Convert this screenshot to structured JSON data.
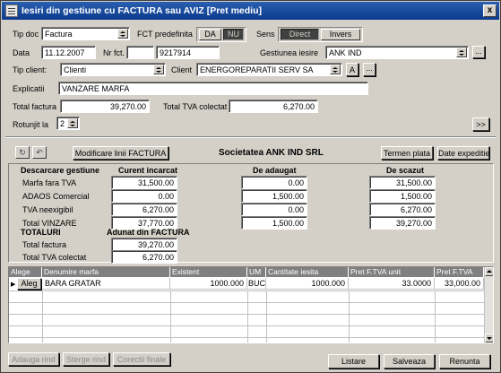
{
  "window": {
    "title": "Iesiri din gestiune cu FACTURA sau AVIZ [Pret mediu]",
    "close": "x"
  },
  "header": {
    "tip_doc_label": "Tip doc",
    "tip_doc_value": "Factura",
    "fct_predefinita_label": "FCT predefinita",
    "da": "DA",
    "nu": "NU",
    "sens_label": "Sens",
    "direct": "Direct",
    "invers": "Invers",
    "data_label": "Data",
    "data_value": "11.12.2007",
    "nr_fct_label": "Nr fct.",
    "nr_fct_value": "9217914",
    "gestiunea_label": "Gestiunea iesire",
    "gestiunea_value": "ANK IND",
    "tip_client_label": "Tip client:",
    "tip_client_value": "Clienti",
    "client_label": "Client",
    "client_value": "ENERGOREPARATII SERV SA",
    "client_a": "A",
    "dots": "...",
    "explicatii_label": "Explicatii",
    "explicatii_value": "VANZARE MARFA",
    "total_factura_label": "Total factura",
    "total_factura_value": "39,270.00",
    "total_tva_label": "Total TVA colectat",
    "total_tva_value": "6,270.00",
    "rotunjit_label": "Rotunjit la",
    "rotunjit_value": "2",
    "next": ">>"
  },
  "middle": {
    "modify_button": "Modificare linii FACTURA",
    "societatea": "Societatea  ANK IND SRL",
    "termen_plata": "Termen plata",
    "date_expeditie": "Date expeditie"
  },
  "summary": {
    "descarcare_header": "Descarcare gestiune",
    "col_curent": "Curent incarcat",
    "col_adaugat": "De adaugat",
    "col_scazut": "De scazut",
    "rows": [
      {
        "label": "Marfa fara TVA",
        "curent": "31,500.00",
        "adaugat": "0.00",
        "scazut": "31,500.00"
      },
      {
        "label": "ADAOS Comercial",
        "curent": "0.00",
        "adaugat": "1,500.00",
        "scazut": "1,500.00"
      },
      {
        "label": "TVA neexigibil",
        "curent": "6,270.00",
        "adaugat": "0.00",
        "scazut": "6,270.00"
      },
      {
        "label": "Total VINZARE",
        "curent": "37,770.00",
        "adaugat": "1,500.00",
        "scazut": "39,270.00"
      }
    ],
    "totaluri_label": "TOTALURI",
    "adunat_label": "Adunat din FACTURA",
    "total_factura_label": "Total factura",
    "total_factura_value": "39,270.00",
    "total_tva_label": "Total TVA colectat",
    "total_tva_value": "6,270.00"
  },
  "grid": {
    "columns": [
      "Alege",
      "Denumire marfa",
      "Existent",
      "UM",
      "Cantitate iesita",
      "Pret F.TVA unit",
      "Pret F.TVA"
    ],
    "rows": [
      {
        "alege": "Aleg",
        "denumire": "BARA GRATAR",
        "existent": "1000.000",
        "um": "BUC",
        "cantitate": "1000.000",
        "pret_unit": "33.0000",
        "pret": "33,000.00"
      }
    ]
  },
  "footer": {
    "adauga": "Adauga rind",
    "sterge": "Sterge rind",
    "corectii": "Corectii finale",
    "listare": "Listare",
    "salveaza": "Salveaza",
    "renunta": "Renunta"
  }
}
